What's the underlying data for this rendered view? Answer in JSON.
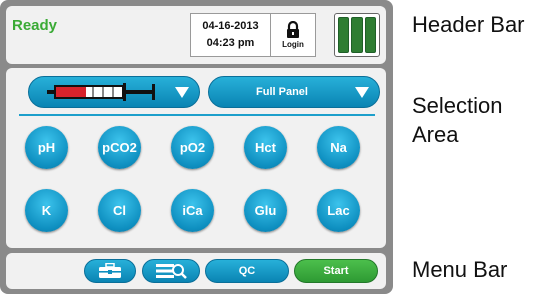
{
  "header": {
    "status": "Ready",
    "date": "04-16-2013",
    "time": "04:23 pm",
    "login_label": "Login",
    "battery_cells": 3
  },
  "selection": {
    "syringe_icon": "syringe-icon",
    "panel_label": "Full Panel",
    "analytes_row1": [
      "pH",
      "pCO2",
      "pO2",
      "Hct",
      "Na"
    ],
    "analytes_row2": [
      "K",
      "Cl",
      "iCa",
      "Glu",
      "Lac"
    ]
  },
  "menu": {
    "toolbox_icon": "toolbox-icon",
    "search_list_icon": "search-list-icon",
    "qc_label": "QC",
    "start_label": "Start"
  },
  "callouts": {
    "header": "Header Bar",
    "selection_line1": "Selection",
    "selection_line2": "Area",
    "menu": "Menu Bar"
  },
  "colors": {
    "status_green": "#3aaa35",
    "button_blue": "#0e8fc0",
    "start_green": "#3aa93e",
    "battery_green": "#2e7d32",
    "bezel_gray": "#8a8a8a"
  }
}
